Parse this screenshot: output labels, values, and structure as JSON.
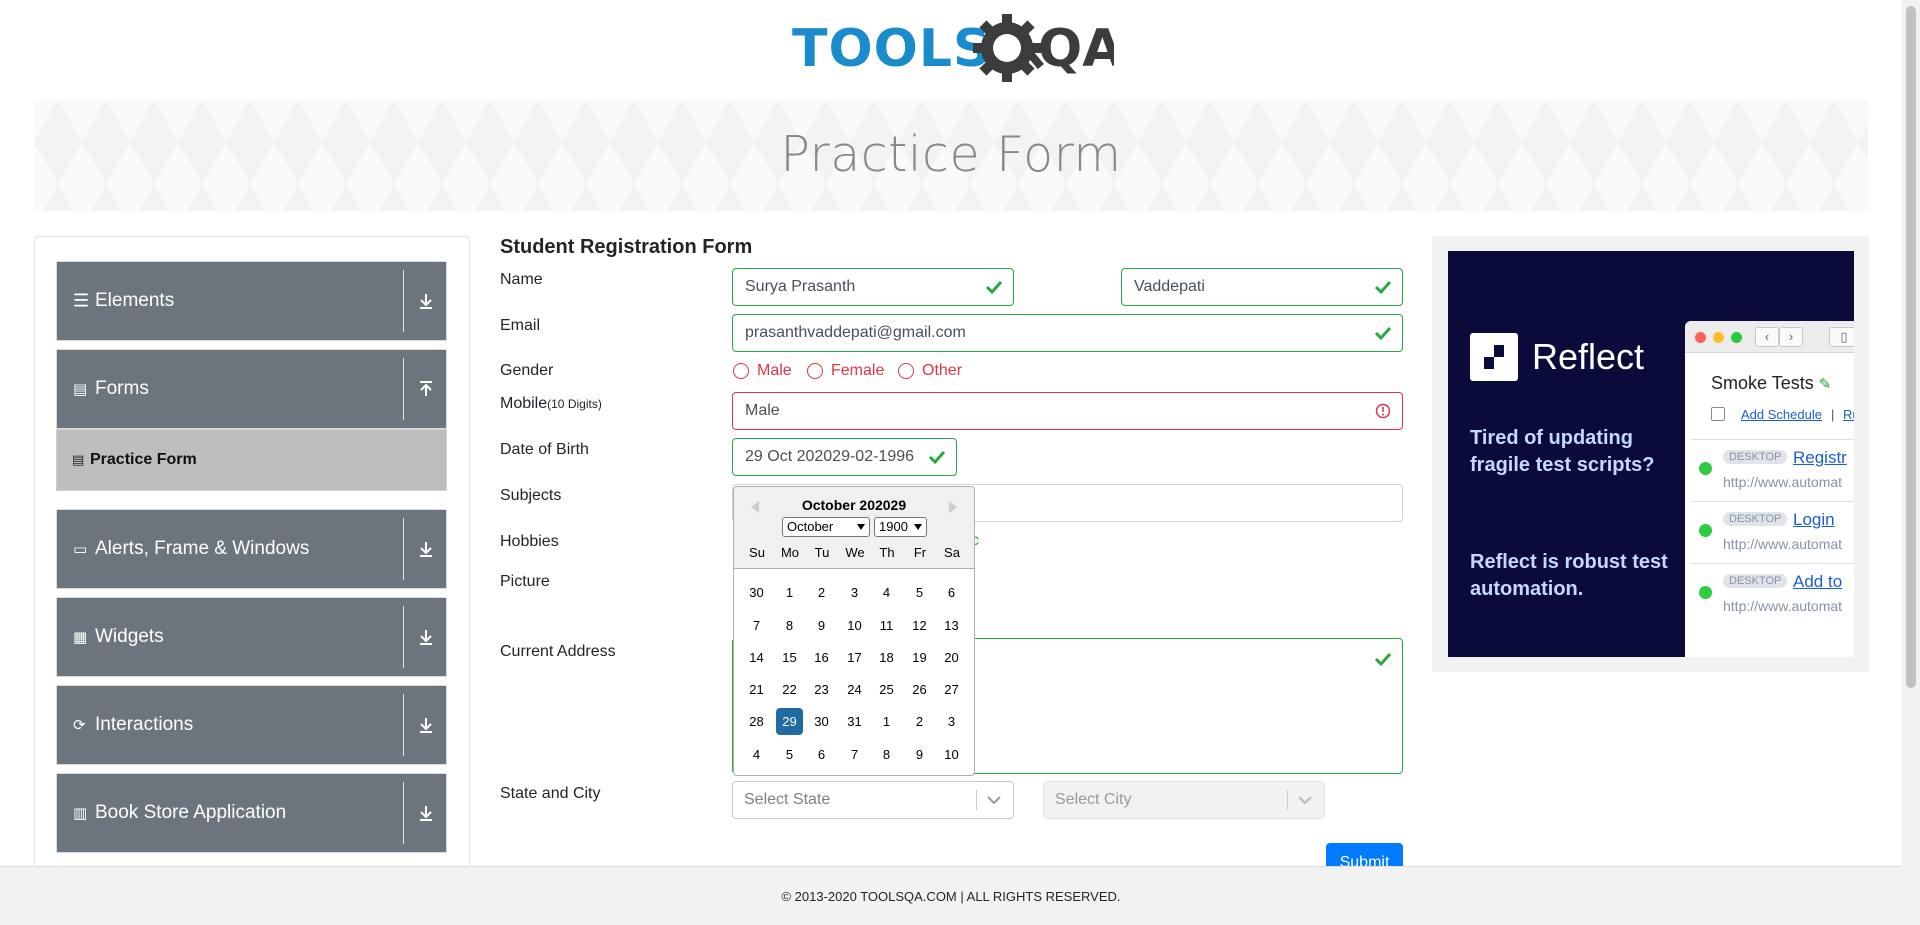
{
  "logo": {
    "text_a": "TOOLS",
    "text_b": "QA"
  },
  "page_title": "Practice Form",
  "sidebar": {
    "groups": [
      {
        "label": "Elements",
        "icon": "menu-icon"
      },
      {
        "label": "Forms",
        "icon": "document-icon"
      },
      {
        "label": "Alerts, Frame & Windows",
        "icon": "window-icon"
      },
      {
        "label": "Widgets",
        "icon": "grid-icon"
      },
      {
        "label": "Interactions",
        "icon": "refresh-icon"
      },
      {
        "label": "Book Store Application",
        "icon": "books-icon"
      }
    ],
    "active_item": {
      "label": "Practice Form",
      "icon": "document-icon"
    }
  },
  "form": {
    "title": "Student Registration Form",
    "labels": {
      "name": "Name",
      "email": "Email",
      "gender": "Gender",
      "mobile": "Mobile",
      "mobile_hint": "(10 Digits)",
      "dob": "Date of Birth",
      "subjects": "Subjects",
      "hobbies": "Hobbies",
      "picture": "Picture",
      "address": "Current Address",
      "state_city": "State and City"
    },
    "first_name": "Surya Prasanth",
    "last_name": "Vaddepati",
    "email": "prasanthvaddepati@gmail.com",
    "gender_options": [
      "Male",
      "Female",
      "Other"
    ],
    "mobile": "Male",
    "dob": "29 Oct 202029-02-1996",
    "hobby_visible_tail": "c",
    "state_placeholder": "Select State",
    "city_placeholder": "Select City",
    "submit": "Submit"
  },
  "datepicker": {
    "title": "October 202029",
    "month_select": "October",
    "year_select": "1900",
    "weekdays": [
      "Su",
      "Mo",
      "Tu",
      "We",
      "Th",
      "Fr",
      "Sa"
    ],
    "weeks": [
      [
        "30",
        "1",
        "2",
        "3",
        "4",
        "5",
        "6"
      ],
      [
        "7",
        "8",
        "9",
        "10",
        "11",
        "12",
        "13"
      ],
      [
        "14",
        "15",
        "16",
        "17",
        "18",
        "19",
        "20"
      ],
      [
        "21",
        "22",
        "23",
        "24",
        "25",
        "26",
        "27"
      ],
      [
        "28",
        "29",
        "30",
        "31",
        "1",
        "2",
        "3"
      ],
      [
        "4",
        "5",
        "6",
        "7",
        "8",
        "9",
        "10"
      ]
    ],
    "selected_day": "29"
  },
  "ad": {
    "brand": "Reflect",
    "headline": "Tired of updating fragile test scripts?",
    "tagline": "Reflect is robust test automation.",
    "window_title": "Smoke Tests",
    "schedule_link": "Add Schedule",
    "schedule_sep": "|",
    "schedule_tail": "Ru",
    "rows": [
      {
        "tag": "DESKTOP",
        "link": "Registr",
        "url": "http://www.automat"
      },
      {
        "tag": "DESKTOP",
        "link": "Login",
        "url": "http://www.automat"
      },
      {
        "tag": "DESKTOP",
        "link": "Add to",
        "url": "http://www.automat"
      }
    ]
  },
  "footer": "© 2013-2020 TOOLSQA.COM | ALL RIGHTS RESERVED.",
  "colors": {
    "valid": "#28a745",
    "invalid": "#dc3545",
    "sidebar": "#6c757d",
    "primary": "#007bff",
    "logo_blue": "#1b8ccb"
  }
}
